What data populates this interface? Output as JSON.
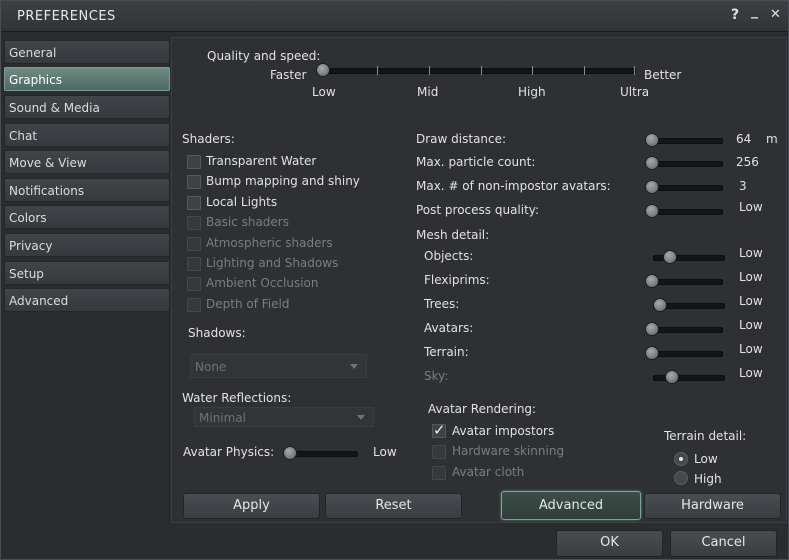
{
  "window": {
    "title": "PREFERENCES",
    "help_glyph": "?",
    "minimize_glyph": "_",
    "close_glyph": "✕"
  },
  "sidebar": {
    "items": [
      {
        "label": "General",
        "active": false
      },
      {
        "label": "Graphics",
        "active": true
      },
      {
        "label": "Sound & Media",
        "active": false
      },
      {
        "label": "Chat",
        "active": false
      },
      {
        "label": "Move & View",
        "active": false
      },
      {
        "label": "Notifications",
        "active": false
      },
      {
        "label": "Colors",
        "active": false
      },
      {
        "label": "Privacy",
        "active": false
      },
      {
        "label": "Setup",
        "active": false
      },
      {
        "label": "Advanced",
        "active": false
      }
    ]
  },
  "quality": {
    "label": "Quality and speed:",
    "left_label": "Faster",
    "right_label": "Better",
    "ticks": [
      "Low",
      "Mid",
      "High",
      "Ultra"
    ],
    "value_fraction": 0
  },
  "shaders": {
    "label": "Shaders:",
    "items": [
      {
        "label": "Transparent Water",
        "checked": false,
        "enabled": true
      },
      {
        "label": "Bump mapping and shiny",
        "checked": false,
        "enabled": true
      },
      {
        "label": "Local Lights",
        "checked": false,
        "enabled": true
      },
      {
        "label": "Basic shaders",
        "checked": false,
        "enabled": false
      },
      {
        "label": "Atmospheric shaders",
        "checked": false,
        "enabled": false
      },
      {
        "label": "Lighting and Shadows",
        "checked": false,
        "enabled": false
      },
      {
        "label": "Ambient Occlusion",
        "checked": false,
        "enabled": false
      },
      {
        "label": "Depth of Field",
        "checked": false,
        "enabled": false
      }
    ]
  },
  "shadows": {
    "label": "Shadows:",
    "value": "None"
  },
  "water": {
    "label": "Water Reflections:",
    "value": "Minimal"
  },
  "avatar_physics": {
    "label": "Avatar Physics:",
    "value": "Low",
    "value_fraction": 0
  },
  "right_sliders": [
    {
      "label": "Draw distance:",
      "value": "64",
      "unit": "m",
      "value_fraction": 0
    },
    {
      "label": "Max. particle count:",
      "value": "256",
      "unit": "",
      "value_fraction": 0
    },
    {
      "label": "Max. # of non-impostor avatars:",
      "value": "3",
      "unit": "",
      "value_fraction": 0
    },
    {
      "label": "Post process quality:",
      "value": "Low",
      "unit": "",
      "value_fraction": 0
    }
  ],
  "mesh": {
    "label": "Mesh detail:",
    "items": [
      {
        "label": "Objects:",
        "value": "Low",
        "enabled": true,
        "value_fraction": 0.25
      },
      {
        "label": "Flexiprims:",
        "value": "Low",
        "enabled": true,
        "value_fraction": 0
      },
      {
        "label": "Trees:",
        "value": "Low",
        "enabled": true,
        "value_fraction": 0.12
      },
      {
        "label": "Avatars:",
        "value": "Low",
        "enabled": true,
        "value_fraction": 0
      },
      {
        "label": "Terrain:",
        "value": "Low",
        "enabled": true,
        "value_fraction": 0
      },
      {
        "label": "Sky:",
        "value": "Low",
        "enabled": false,
        "value_fraction": 0.3
      }
    ]
  },
  "avatar_rendering": {
    "label": "Avatar Rendering:",
    "items": [
      {
        "label": "Avatar impostors",
        "checked": true,
        "enabled": true
      },
      {
        "label": "Hardware skinning",
        "checked": false,
        "enabled": false
      },
      {
        "label": "Avatar cloth",
        "checked": false,
        "enabled": false
      }
    ]
  },
  "terrain_detail": {
    "label": "Terrain detail:",
    "options": [
      {
        "label": "Low",
        "selected": true
      },
      {
        "label": "High",
        "selected": false
      }
    ]
  },
  "panel_buttons": {
    "apply": "Apply",
    "reset": "Reset",
    "advanced": "Advanced",
    "hardware": "Hardware"
  },
  "footer_buttons": {
    "ok": "OK",
    "cancel": "Cancel"
  },
  "colors": {
    "accent": "#6e8c82",
    "window_bg": "#2a2c2f",
    "panel_bg": "#2e3033"
  }
}
